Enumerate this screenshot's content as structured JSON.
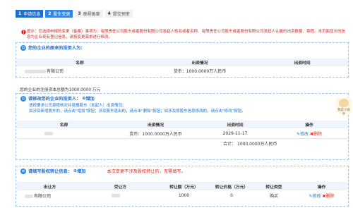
{
  "steps": [
    {
      "num": "1",
      "label": "申请信息",
      "state": "active"
    },
    {
      "num": "2",
      "label": "股东变更",
      "state": "dest"
    },
    {
      "num": "3",
      "label": "章程备案",
      "state": "inactive"
    },
    {
      "num": "4",
      "label": "提交预审",
      "state": "inactive"
    }
  ],
  "tip": {
    "icon": "warning-icon",
    "text": "提示：您选择申报的变更（备案）事项为：有限责任公司股东或者股份有限公司发起人姓名或者名称、有限责任公司股东或者股份有限公司发起人认缴的出资数额、章程。本页面显示的信息为企业现有登记信息，请按变更需求进行修改。"
  },
  "original": {
    "title": "您的企业的原来的投资人为：",
    "headers": [
      "名称",
      "出资情况",
      "出资时间"
    ],
    "rows": [
      {
        "name_suffix": "有限公司",
        "capital": "货币：1000.0000万人民币",
        "time": ""
      }
    ]
  },
  "registered_capital": "您的企业的注册资本总额为1000.0000 万元",
  "changed": {
    "title": "请修改您的企业的投资人：",
    "add_label": "增加",
    "notes": [
      "请按要求公司章程核对并填报股东（发起人）出资情况。",
      "如涉及新增股东的，请点击\"增加\"按钮；涉及股东退出的，请点击\"删除\"按钮；如涉及原股东信息修改的，请点击\"修改\"按钮。"
    ],
    "headers": [
      "名称",
      "出资情况",
      "出资时间",
      "操作"
    ],
    "rows": [
      {
        "name": "",
        "capital": "货币：1000.0000万人民币",
        "time": "2029-11-17",
        "edit_label": "修改",
        "delete_label": "删除"
      }
    ],
    "total_label": "合计：",
    "total_value": "1000.0000万人民币"
  },
  "transfer": {
    "title": "请填写股权转让信息：",
    "add_label": "增加",
    "note": "本次变更不涉及股权转让的，无需填写。",
    "headers": [
      "出让方",
      "受让方",
      "转让额（万元）",
      "转让价格（万元）",
      "转让类型",
      "操作"
    ],
    "rows": [
      {
        "from_suffix": "有限公司",
        "to": "",
        "amount": "1000",
        "price": "0",
        "type": "购买",
        "edit_label": "修改",
        "delete_label": "删除"
      }
    ]
  },
  "side_widget": {
    "label": "我是小助手"
  },
  "colors": {
    "primary": "#1f6fd0",
    "danger": "#d9261c",
    "header_bg": "#eef4fb"
  }
}
